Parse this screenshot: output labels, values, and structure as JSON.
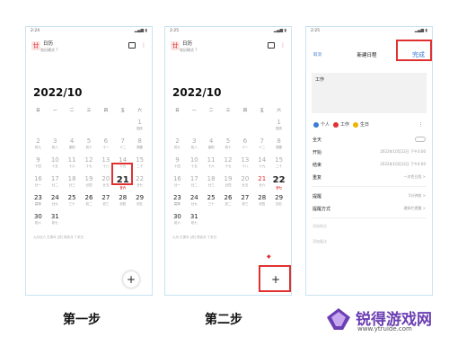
{
  "phone1": {
    "status_time": "2:24",
    "app_title": "日历",
    "app_subtitle": "农历模式 ?",
    "year_month": "2022/10",
    "weekdays": [
      "日",
      "一",
      "二",
      "三",
      "四",
      "五",
      "六"
    ],
    "days": [
      {
        "d": "",
        "l": ""
      },
      {
        "d": "",
        "l": ""
      },
      {
        "d": "",
        "l": ""
      },
      {
        "d": "",
        "l": ""
      },
      {
        "d": "",
        "l": ""
      },
      {
        "d": "",
        "l": ""
      },
      {
        "d": "1",
        "l": "国庆"
      },
      {
        "d": "2",
        "l": "初七"
      },
      {
        "d": "3",
        "l": "初八"
      },
      {
        "d": "4",
        "l": "重阳"
      },
      {
        "d": "5",
        "l": "初十"
      },
      {
        "d": "6",
        "l": "十一"
      },
      {
        "d": "7",
        "l": "十二"
      },
      {
        "d": "8",
        "l": "寒露"
      },
      {
        "d": "9",
        "l": "十四"
      },
      {
        "d": "10",
        "l": "十五"
      },
      {
        "d": "11",
        "l": "十六"
      },
      {
        "d": "12",
        "l": "十七"
      },
      {
        "d": "13",
        "l": "十八"
      },
      {
        "d": "14",
        "l": "十九"
      },
      {
        "d": "15",
        "l": "二十"
      },
      {
        "d": "16",
        "l": "廿一"
      },
      {
        "d": "17",
        "l": "廿二"
      },
      {
        "d": "18",
        "l": "廿三"
      },
      {
        "d": "19",
        "l": "廿四"
      },
      {
        "d": "20",
        "l": "廿五"
      },
      {
        "d": "21",
        "l": "廿六"
      },
      {
        "d": "22",
        "l": "廿七"
      },
      {
        "d": "23",
        "l": "霜降"
      },
      {
        "d": "24",
        "l": "廿九"
      },
      {
        "d": "25",
        "l": "三十"
      },
      {
        "d": "26",
        "l": "初二"
      },
      {
        "d": "27",
        "l": "初三"
      },
      {
        "d": "28",
        "l": "初四"
      },
      {
        "d": "29",
        "l": "初五"
      },
      {
        "d": "30",
        "l": "初六"
      },
      {
        "d": "31",
        "l": "初七"
      }
    ],
    "footer": "九月廿六 壬寅年 [虎] 癸亥月 丁未日"
  },
  "phone2": {
    "status_time": "2:25",
    "app_title": "日历",
    "app_subtitle": "农历模式 ?",
    "year_month": "2022/10",
    "footer": "九月 壬寅年 [虎] 癸亥月 丁未日"
  },
  "phone3": {
    "cancel": "取消",
    "title": "新建日程",
    "done": "完成",
    "event_title": "工作",
    "tags": [
      {
        "label": "个人",
        "color": "#3a7bd5"
      },
      {
        "label": "工作",
        "color": "#e03131"
      },
      {
        "label": "生日",
        "color": "#f0b400"
      }
    ],
    "rows": [
      {
        "label": "全天",
        "value": ""
      },
      {
        "label": "开始",
        "value": "2022年10月22日 下午3:00"
      },
      {
        "label": "结束",
        "value": "2022年10月22日 下午4:00"
      },
      {
        "label": "重复",
        "value": "一次性日程 >"
      },
      {
        "label": "提醒",
        "value": "5分钟前 >"
      },
      {
        "label": "提醒方式",
        "value": "通知栏提醒 >"
      }
    ],
    "hint_location": "添加地点",
    "hint_notes": "添加备注"
  },
  "captions": {
    "step1": "第一步",
    "step2": "第二步"
  },
  "watermark": {
    "title": "锐得游戏网",
    "url": "www.ytruide.com"
  },
  "colors": {
    "accent_red": "#e03131",
    "accent_blue": "#3a7bd5",
    "frame": "#c9e3f1"
  }
}
